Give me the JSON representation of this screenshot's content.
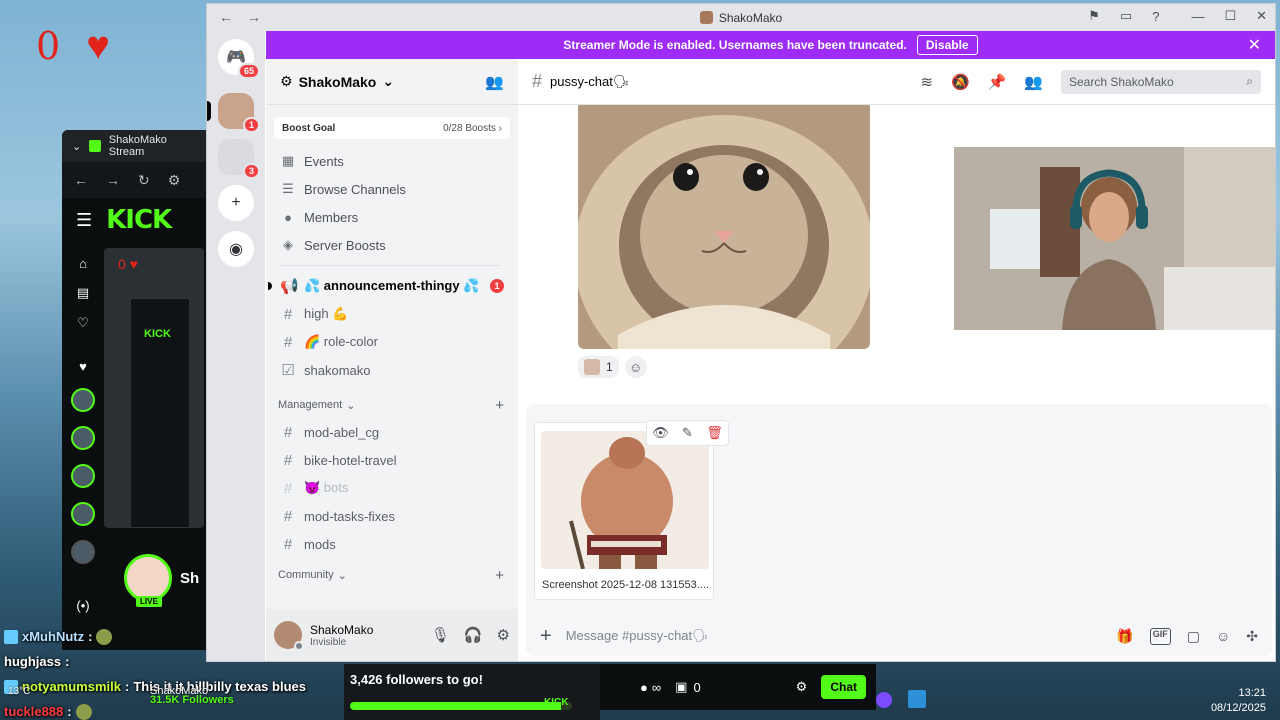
{
  "overlay": {
    "heart_count": "0",
    "mini_heart_count": "0",
    "kick_tab_title": "ShakoMako Stream",
    "kick_logo": "KICK",
    "mini_kick_logo": "KICK",
    "streamer_short": "Sh",
    "live_label": "LIVE",
    "followers_label": "ShakoMako",
    "followers_count": "31.5K Followers",
    "weather": "13°C",
    "chat": [
      {
        "user": "xMuhNutz",
        "sep": ":",
        "msg": ""
      },
      {
        "user": "hughjass",
        "sep": ":",
        "msg": ""
      },
      {
        "user": "notyamumsmilk",
        "sep": ":",
        "msg": "This it it hillbilly texas blues"
      },
      {
        "user": "tuckle888",
        "sep": ":",
        "msg": ""
      }
    ]
  },
  "stream_bar": {
    "goal_text": "3,426 followers to go!",
    "goal_progress": 0.95,
    "goal_brand": "KICK",
    "viewer_symbol": "∞",
    "gift_count": "0",
    "chat_button": "Chat"
  },
  "clock": {
    "time": "13:21",
    "date": "08/12/2025"
  },
  "discord": {
    "window_title": "ShakoMako",
    "rail_badges": {
      "home": "65",
      "server1": "1",
      "folder": "3"
    },
    "banner": {
      "text": "Streamer Mode is enabled. Usernames have been truncated.",
      "button": "Disable"
    },
    "guild": {
      "name": "ShakoMako",
      "boost_goal_label": "Boost Goal",
      "boost_progress": "0/28 Boosts"
    },
    "nav_items": [
      {
        "icon": "calendar-icon",
        "glyph": "▦",
        "label": "Events"
      },
      {
        "icon": "browse-channels-icon",
        "glyph": "☰",
        "label": "Browse Channels"
      },
      {
        "icon": "members-icon",
        "glyph": "👤",
        "label": "Members"
      },
      {
        "icon": "server-boost-icon",
        "glyph": "◈",
        "label": "Server Boosts"
      }
    ],
    "channels_top": [
      {
        "name": "💦 announcement-thingy 💦",
        "icon": "megaphone-icon",
        "glyph": "📢",
        "unread": true,
        "ping": "1"
      },
      {
        "name": "high 💪",
        "icon": "hash-icon",
        "glyph": "#",
        "unread": false,
        "ping": ""
      },
      {
        "name": "🌈 role-color",
        "icon": "hash-icon",
        "glyph": "#",
        "unread": false,
        "ping": ""
      },
      {
        "name": "shakomako",
        "icon": "checklist-icon",
        "glyph": "☑",
        "unread": false,
        "ping": ""
      }
    ],
    "category_management": "Management",
    "channels_management": [
      {
        "name": "mod-abel_cg",
        "muted": false
      },
      {
        "name": "bike-hotel-travel",
        "muted": false
      },
      {
        "name": "👿 bots",
        "muted": true
      },
      {
        "name": "mod-tasks-fixes",
        "muted": false
      },
      {
        "name": "mods",
        "muted": false
      }
    ],
    "category_community": "Community",
    "user_panel": {
      "name": "ShakoMako",
      "status": "Invisible"
    },
    "chat_header": {
      "channel": "pussy-chat🗣",
      "search_placeholder": "Search ShakoMako"
    },
    "reactions": [
      {
        "count": "1"
      }
    ],
    "attachment": {
      "filename": "Screenshot 2025-12-08 131553...."
    },
    "composer_placeholder": "Message #pussy-chat🗣",
    "colors": {
      "banner": "#9e2bf6",
      "kick_green": "#53fc18",
      "ping_red": "#f23f43"
    }
  }
}
